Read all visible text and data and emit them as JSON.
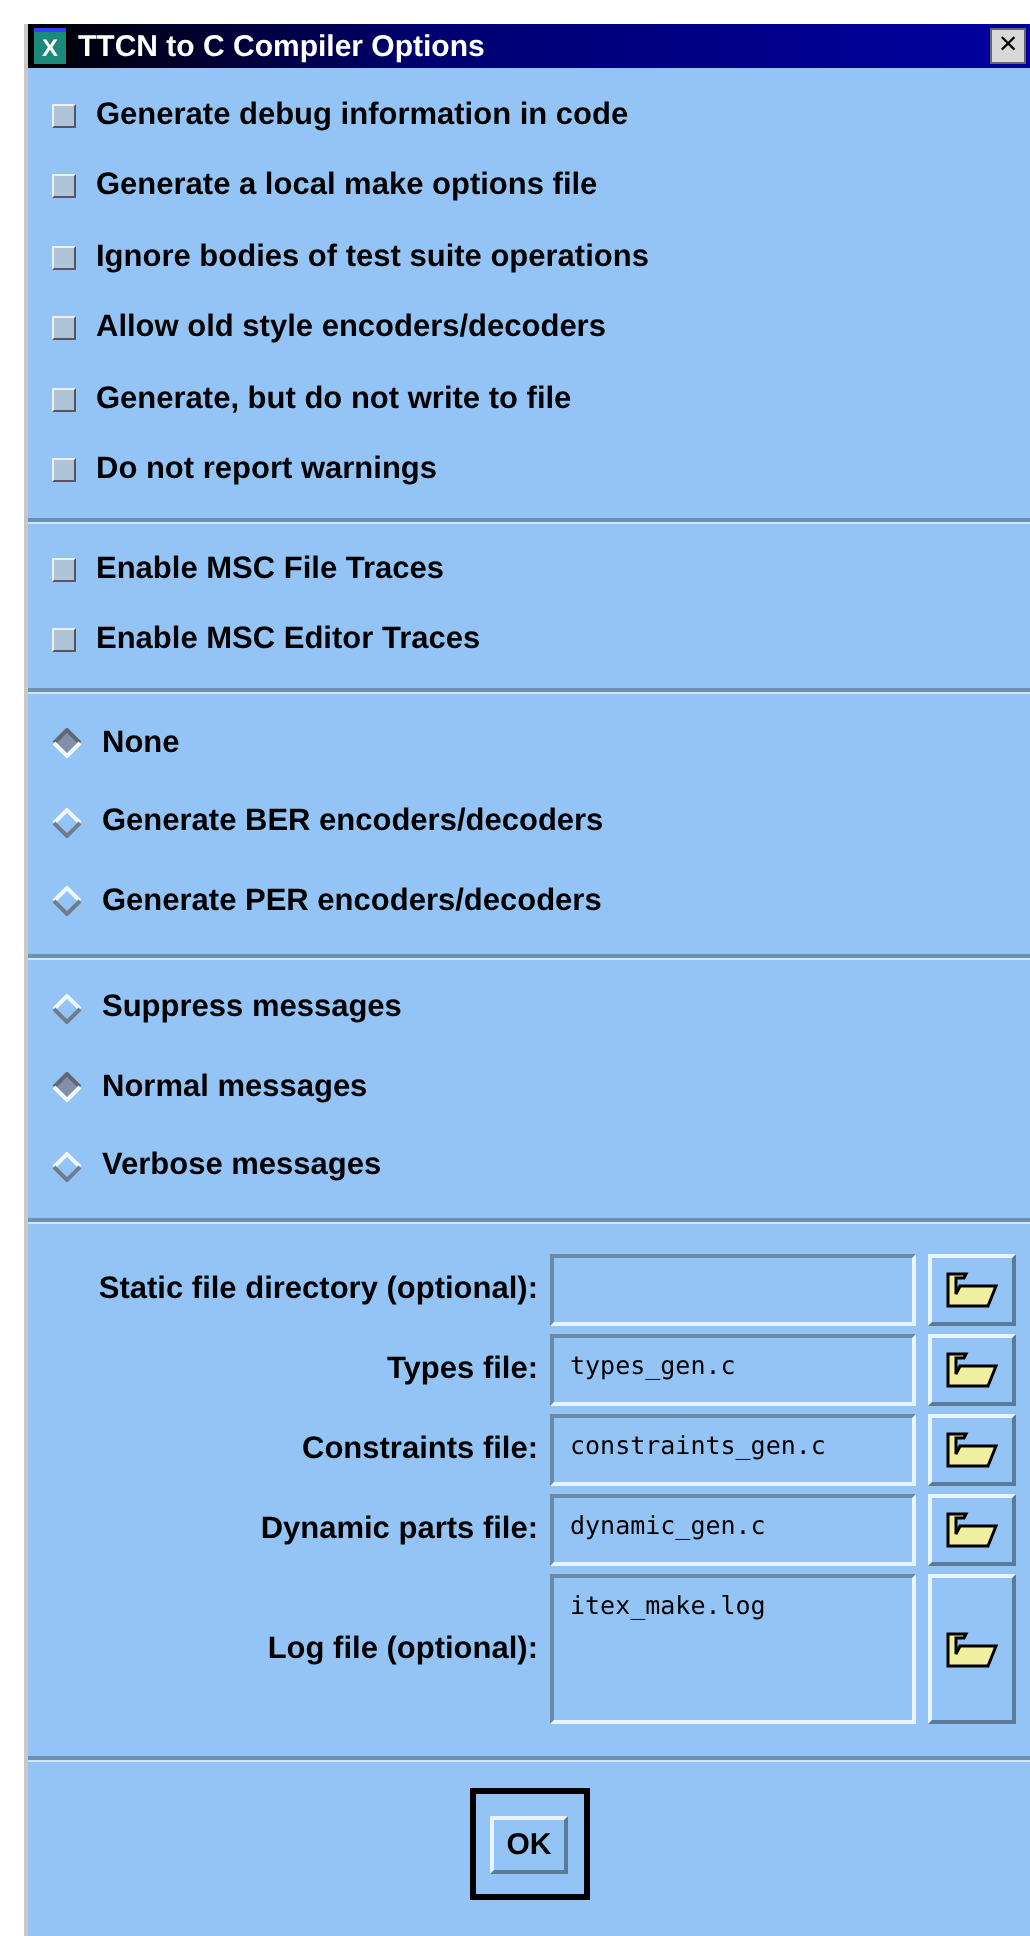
{
  "window": {
    "title": "TTCN to C Compiler Options",
    "close": "×",
    "app_icon": "X"
  },
  "checkbox_groups": [
    [
      {
        "label": "Generate debug information in code",
        "checked": false
      },
      {
        "label": "Generate a local make options file",
        "checked": false
      },
      {
        "label": "Ignore bodies of test suite operations",
        "checked": false
      },
      {
        "label": "Allow old style encoders/decoders",
        "checked": false
      },
      {
        "label": "Generate, but do not write to file",
        "checked": false
      },
      {
        "label": "Do not report warnings",
        "checked": false
      }
    ],
    [
      {
        "label": "Enable MSC File Traces",
        "checked": false
      },
      {
        "label": "Enable MSC Editor Traces",
        "checked": false
      }
    ]
  ],
  "radio_groups": [
    [
      {
        "label": "None",
        "selected": true
      },
      {
        "label": "Generate BER encoders/decoders",
        "selected": false
      },
      {
        "label": "Generate PER encoders/decoders",
        "selected": false
      }
    ],
    [
      {
        "label": "Suppress messages",
        "selected": false
      },
      {
        "label": "Normal messages",
        "selected": true
      },
      {
        "label": "Verbose messages",
        "selected": false
      }
    ]
  ],
  "fields": [
    {
      "label": "Static file directory (optional):",
      "kind": "line"
    },
    {
      "label": "Types file:",
      "value": "types_gen.c",
      "kind": "line"
    },
    {
      "label": "Constraints file:",
      "value": "constraints_gen.c",
      "kind": "line"
    },
    {
      "label": "Dynamic parts file:",
      "value": "dynamic_gen.c",
      "kind": "line"
    },
    {
      "label": "Log file (optional):",
      "value": "itex_make.log",
      "kind": "multiline"
    }
  ],
  "buttons": [
    "OK"
  ]
}
